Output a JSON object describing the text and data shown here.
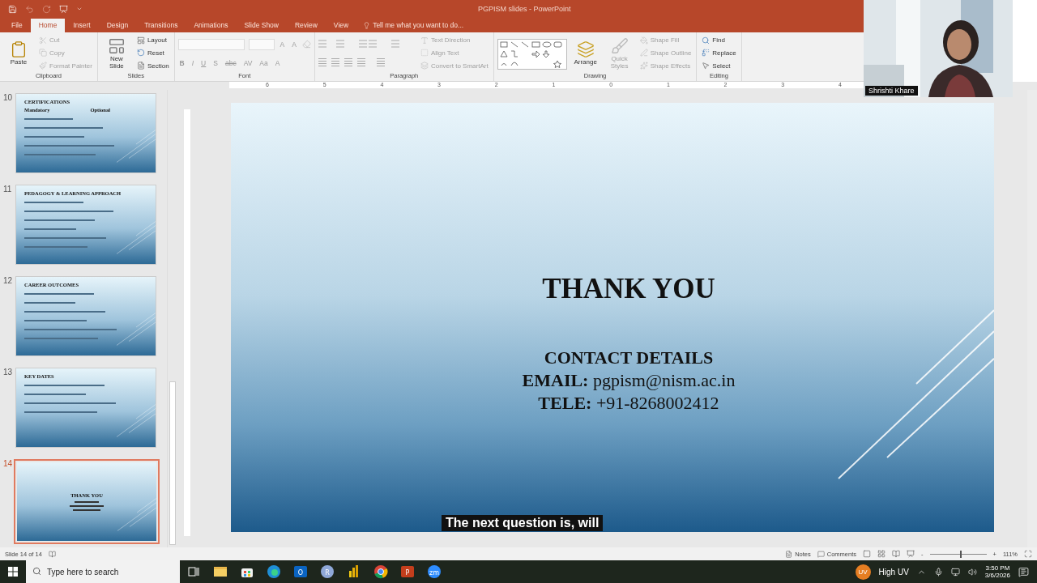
{
  "titlebar": {
    "title": "PGPISM slides - PowerPoint"
  },
  "tabs": [
    {
      "label": "File",
      "selected": false
    },
    {
      "label": "Home",
      "selected": true
    },
    {
      "label": "Insert",
      "selected": false
    },
    {
      "label": "Design",
      "selected": false
    },
    {
      "label": "Transitions",
      "selected": false
    },
    {
      "label": "Animations",
      "selected": false
    },
    {
      "label": "Slide Show",
      "selected": false
    },
    {
      "label": "Review",
      "selected": false
    },
    {
      "label": "View",
      "selected": false
    }
  ],
  "tell_me": {
    "placeholder": "Tell me what you want to do..."
  },
  "ribbon": {
    "groups": [
      {
        "label": "Clipboard",
        "columns": [
          [
            {
              "kind": "large",
              "label": "Paste",
              "disabled": false
            }
          ],
          [
            {
              "kind": "small",
              "label": "Cut",
              "disabled": true
            },
            {
              "kind": "small",
              "label": "Copy",
              "disabled": true
            },
            {
              "kind": "small",
              "label": "Format Painter",
              "disabled": true
            }
          ]
        ]
      },
      {
        "label": "Slides",
        "columns": [
          [
            {
              "kind": "large",
              "label": "New Slide",
              "disabled": false
            }
          ],
          [
            {
              "kind": "small",
              "label": "Layout",
              "disabled": false
            },
            {
              "kind": "small",
              "label": "Reset",
              "disabled": false
            },
            {
              "kind": "small",
              "label": "Section",
              "disabled": false
            }
          ]
        ]
      },
      {
        "label": "Font",
        "columns": [
          [
            {
              "kind": "fields",
              "glyphs": [
                "A",
                "A"
              ]
            },
            {
              "kind": "glyphs",
              "glyphs": [
                "B",
                "I",
                "U",
                "S",
                "abc",
                "AV",
                "Aa",
                "A"
              ]
            }
          ]
        ]
      },
      {
        "label": "Paragraph",
        "columns": [
          [
            {
              "kind": "list-icons"
            },
            {
              "kind": "align-icons"
            }
          ],
          [
            {
              "kind": "small",
              "label": "Text Direction",
              "disabled": true
            },
            {
              "kind": "small",
              "label": "Align Text",
              "disabled": true
            },
            {
              "kind": "small",
              "label": "Convert to SmartArt",
              "disabled": true
            }
          ]
        ]
      },
      {
        "label": "Drawing",
        "columns": [
          [
            {
              "kind": "shapes"
            }
          ],
          [
            {
              "kind": "large",
              "label": "Arrange",
              "disabled": false
            }
          ],
          [
            {
              "kind": "large",
              "label": "Quick Styles",
              "disabled": true
            }
          ],
          [
            {
              "kind": "small",
              "label": "Shape Fill",
              "disabled": true
            },
            {
              "kind": "small",
              "label": "Shape Outline",
              "disabled": true
            },
            {
              "kind": "small",
              "label": "Shape Effects",
              "disabled": true
            }
          ]
        ]
      },
      {
        "label": "Editing",
        "columns": [
          [
            {
              "kind": "small",
              "label": "Find",
              "disabled": false
            },
            {
              "kind": "small",
              "label": "Replace",
              "disabled": false
            },
            {
              "kind": "small",
              "label": "Select",
              "disabled": false
            }
          ]
        ]
      }
    ]
  },
  "ruler": {
    "labels": [
      "6",
      "5",
      "4",
      "3",
      "2",
      "1",
      "0",
      "1",
      "2",
      "3",
      "4"
    ]
  },
  "thumbnails": [
    {
      "number": "10",
      "kind": "columns",
      "title": "CERTIFICATIONS",
      "subheads": [
        "Mandatory",
        "Optional"
      ],
      "selected": false
    },
    {
      "number": "11",
      "kind": "bullets",
      "title": "PEDAGOGY & LEARNING APPROACH",
      "selected": false
    },
    {
      "number": "12",
      "kind": "bullets",
      "title": "CAREER OUTCOMES",
      "selected": false
    },
    {
      "number": "13",
      "kind": "bullets",
      "title": "KEY DATES",
      "selected": false
    },
    {
      "number": "14",
      "kind": "closing",
      "title": "THANK YOU",
      "selected": true
    }
  ],
  "slide": {
    "title": "THANK YOU",
    "lines": [
      "CONTACT DETAILS",
      "**EMAIL:** pgpism@nism.ac.in",
      "**TELE:** +91-8268002412"
    ]
  },
  "caption": "The next question is, will",
  "video": {
    "name": "Shrishti Khare"
  },
  "status_bar": {
    "slide": "Slide 14 of 14",
    "notes": "Notes",
    "comments": "Comments",
    "zoom_out": "-",
    "zoom_slider": {
      "level": 0.55
    },
    "zoom_in": "+",
    "zoom": "111%"
  },
  "taskbar": {
    "search": {
      "placeholder": "Type here to search"
    },
    "apps": [
      {
        "kind": "taskview"
      },
      {
        "kind": "folder"
      },
      {
        "kind": "store"
      },
      {
        "kind": "edge"
      },
      {
        "kind": "mail",
        "glyph": "O"
      },
      {
        "kind": "circle",
        "glyph": "R"
      },
      {
        "kind": "chart"
      },
      {
        "kind": "chrome"
      },
      {
        "kind": "ppt",
        "glyph": "P"
      },
      {
        "kind": "zoom",
        "glyph": "zm"
      }
    ],
    "weather": {
      "badge": "UV",
      "text": "High UV"
    },
    "time": "3:50 PM",
    "date": "3/6/2026"
  }
}
